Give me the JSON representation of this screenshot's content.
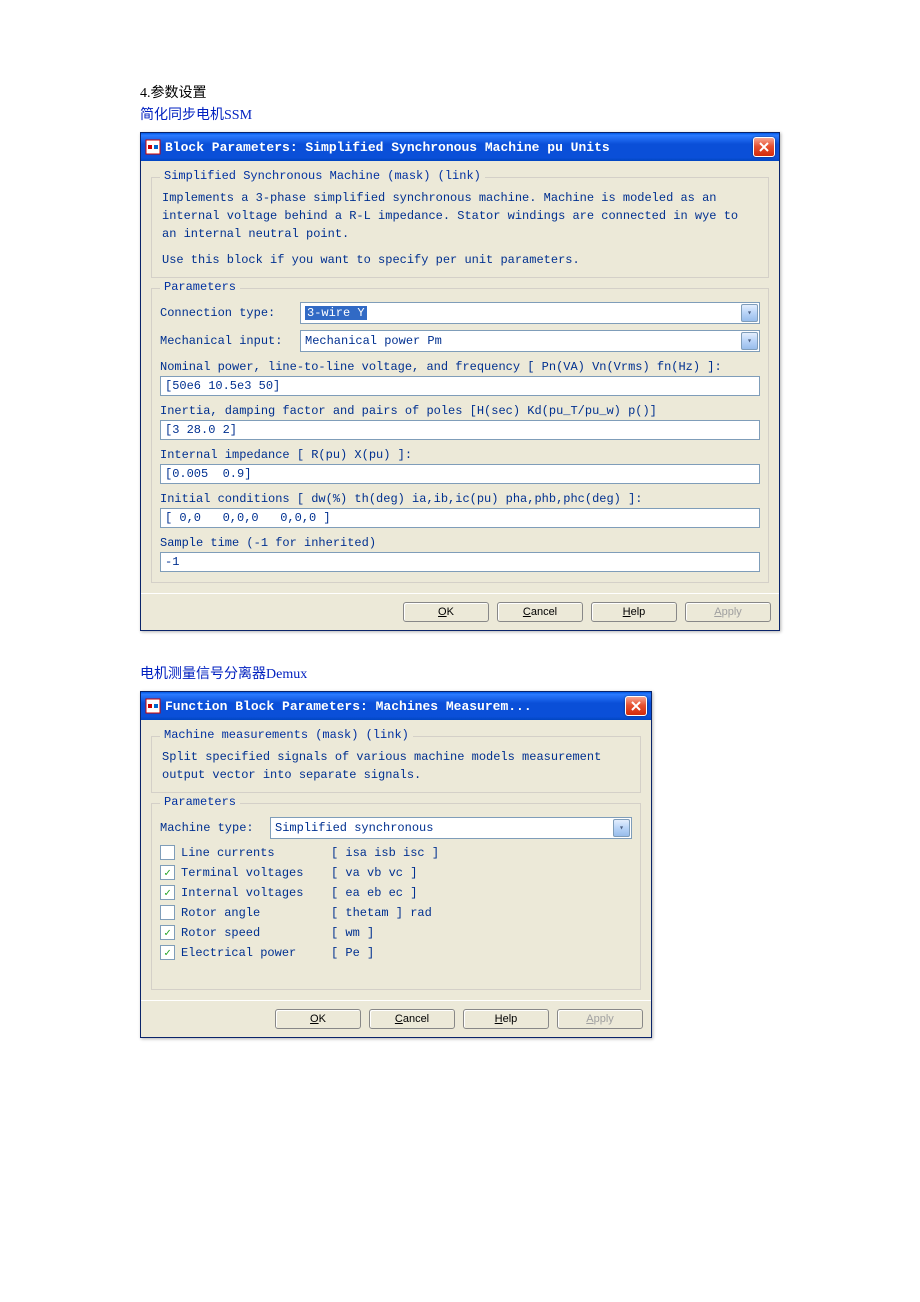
{
  "doc": {
    "line1": "4.参数设置",
    "line2": "简化同步电机SSM",
    "line3": "电机测量信号分离器Demux"
  },
  "dialog1": {
    "title": "Block Parameters: Simplified Synchronous Machine pu Units",
    "group1_label": "Simplified Synchronous Machine (mask) (link)",
    "desc1": "Implements a 3-phase simplified synchronous machine. Machine is modeled as an internal voltage behind a R-L impedance. Stator windings are connected in wye to an internal neutral point.",
    "desc2": "Use this block if you want to specify per unit parameters.",
    "params_label": "Parameters",
    "conn_type_label": "Connection type:",
    "conn_type_value": "3-wire Y",
    "mech_input_label": "Mechanical input:",
    "mech_input_value": "Mechanical power Pm",
    "nominal_label": "Nominal power, line-to-line voltage, and frequency [ Pn(VA) Vn(Vrms) fn(Hz) ]:",
    "nominal_value": "[50e6 10.5e3 50]",
    "inertia_label": "Inertia, damping factor and pairs of poles [H(sec) Kd(pu_T/pu_w) p()]",
    "inertia_value": "[3 28.0 2]",
    "impedance_label": "Internal impedance [ R(pu)  X(pu) ]:",
    "impedance_value": "[0.005  0.9]",
    "initial_label": "Initial conditions [ dw(%)  th(deg)  ia,ib,ic(pu)  pha,phb,phc(deg) ]:",
    "initial_value": "[ 0,0   0,0,0   0,0,0 ]",
    "sample_label": "Sample time (-1 for inherited)",
    "sample_value": "-1",
    "ok": "OK",
    "cancel": "Cancel",
    "help": "Help",
    "apply": "Apply"
  },
  "dialog2": {
    "title": "Function Block Parameters: Machines Measurem...",
    "group1_label": "Machine measurements (mask) (link)",
    "desc": "Split specified signals of various machine models measurement output vector into separate signals.",
    "params_label": "Parameters",
    "mtype_label": "Machine type:",
    "mtype_value": "Simplified synchronous",
    "cb1_label": "Line currents",
    "cb1_vars": "[ isa  isb  isc ]",
    "cb2_label": "Terminal voltages",
    "cb2_vars": "[ va  vb  vc ]",
    "cb3_label": "Internal voltages",
    "cb3_vars": "[ ea  eb  ec ]",
    "cb4_label": "Rotor angle",
    "cb4_vars": "[ thetam ]   rad",
    "cb5_label": "Rotor speed",
    "cb5_vars": "[ wm ]",
    "cb6_label": "Electrical power",
    "cb6_vars": "[ Pe ]",
    "cb1_checked": false,
    "cb2_checked": true,
    "cb3_checked": true,
    "cb4_checked": false,
    "cb5_checked": true,
    "cb6_checked": true,
    "ok": "OK",
    "cancel": "Cancel",
    "help": "Help",
    "apply": "Apply"
  }
}
